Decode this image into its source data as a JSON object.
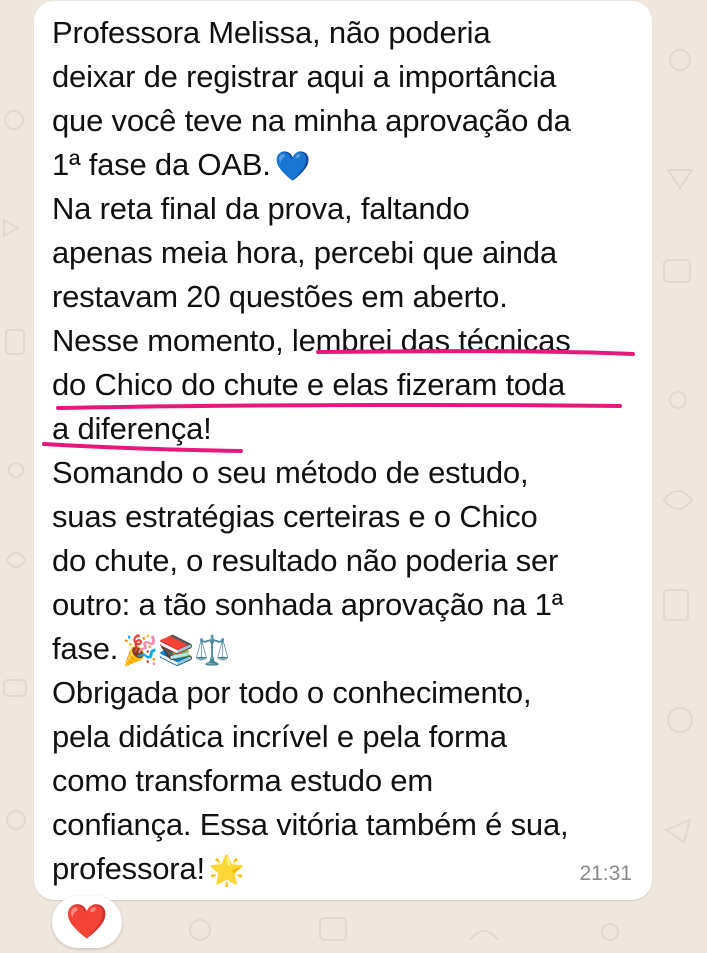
{
  "message": {
    "lines": [
      "Professora Melissa, não poderia",
      "deixar de registrar aqui a importância",
      "que você teve na minha aprovação da",
      "1ª fase da OAB.",
      "Na reta final da prova, faltando",
      "apenas meia hora, percebi que ainda",
      "restavam 20 questões em aberto.",
      "Nesse momento, lembrei das técnicas",
      "do Chico do chute e elas fizeram toda",
      "a diferença!",
      "Somando o seu método de estudo,",
      "suas estratégias certeiras e o Chico",
      "do chute, o resultado não poderia ser",
      "outro: a tão sonhada aprovação na 1ª",
      "fase.",
      "Obrigada por todo o conhecimento,",
      "pela didática incrível e pela forma",
      "como transforma estudo em",
      "confiança. Essa vitória também é sua,",
      "professora!"
    ],
    "emojis": {
      "heart_after_oab": "💙",
      "celebration": "🎉📚⚖️",
      "star": "🌟"
    },
    "timestamp": "21:31"
  },
  "reaction": {
    "emoji": "❤️"
  },
  "colors": {
    "highlight_underline": "#e8177a",
    "bubble_bg": "#ffffff",
    "wallpaper": "#efe7dd",
    "timestamp": "#8a8a8a"
  }
}
